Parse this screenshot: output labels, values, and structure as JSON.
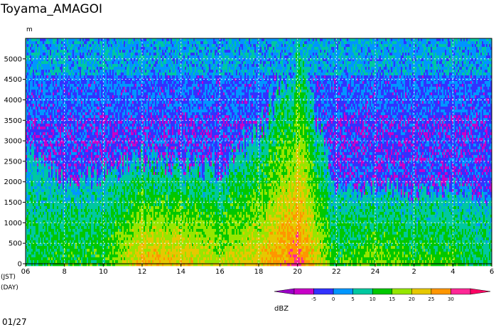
{
  "chart_data": {
    "type": "heatmap",
    "title": "Toyama_AMAGOI",
    "ylabel": "m",
    "xlabel_lines": [
      "(JST)",
      "(DAY)"
    ],
    "x_ticks": [
      "06",
      "8",
      "10",
      "12",
      "14",
      "16",
      "18",
      "20",
      "22",
      "24",
      "2",
      "4",
      "6"
    ],
    "ylim": [
      0,
      5500
    ],
    "y_ticks": [
      0,
      500,
      1000,
      1500,
      2000,
      2500,
      3000,
      3500,
      4000,
      4500,
      5000
    ],
    "grid": true,
    "colorbar": {
      "label": "dBZ",
      "ticks": [
        "-5",
        "0",
        "5",
        "10",
        "15",
        "20",
        "25",
        "30"
      ],
      "colors": [
        "#9b00c8",
        "#c800c8",
        "#3232ff",
        "#0096ff",
        "#00c8a0",
        "#00c800",
        "#96e600",
        "#e6c800",
        "#ff9600",
        "#ff2896",
        "#ff0064"
      ]
    },
    "series": [
      {
        "x": "06",
        "top_m": 2600,
        "peak_dbz": 12
      },
      {
        "x": "8",
        "top_m": 2000,
        "peak_dbz": 16
      },
      {
        "x": "10",
        "top_m": 2200,
        "peak_dbz": 15
      },
      {
        "x": "12",
        "top_m": 2600,
        "peak_dbz": 27
      },
      {
        "x": "14",
        "top_m": 2500,
        "peak_dbz": 26
      },
      {
        "x": "16",
        "top_m": 2300,
        "peak_dbz": 22
      },
      {
        "x": "18",
        "top_m": 3200,
        "peak_dbz": 25
      },
      {
        "x": "20",
        "top_m": 5400,
        "peak_dbz": 33
      },
      {
        "x": "22",
        "top_m": 1800,
        "peak_dbz": 15
      },
      {
        "x": "24",
        "top_m": 1900,
        "peak_dbz": 19
      },
      {
        "x": "2",
        "top_m": 1700,
        "peak_dbz": 16
      },
      {
        "x": "4",
        "top_m": 1900,
        "peak_dbz": 16
      },
      {
        "x": "6",
        "top_m": 1500,
        "peak_dbz": 12
      }
    ]
  },
  "footer": {
    "date": "01/27"
  }
}
